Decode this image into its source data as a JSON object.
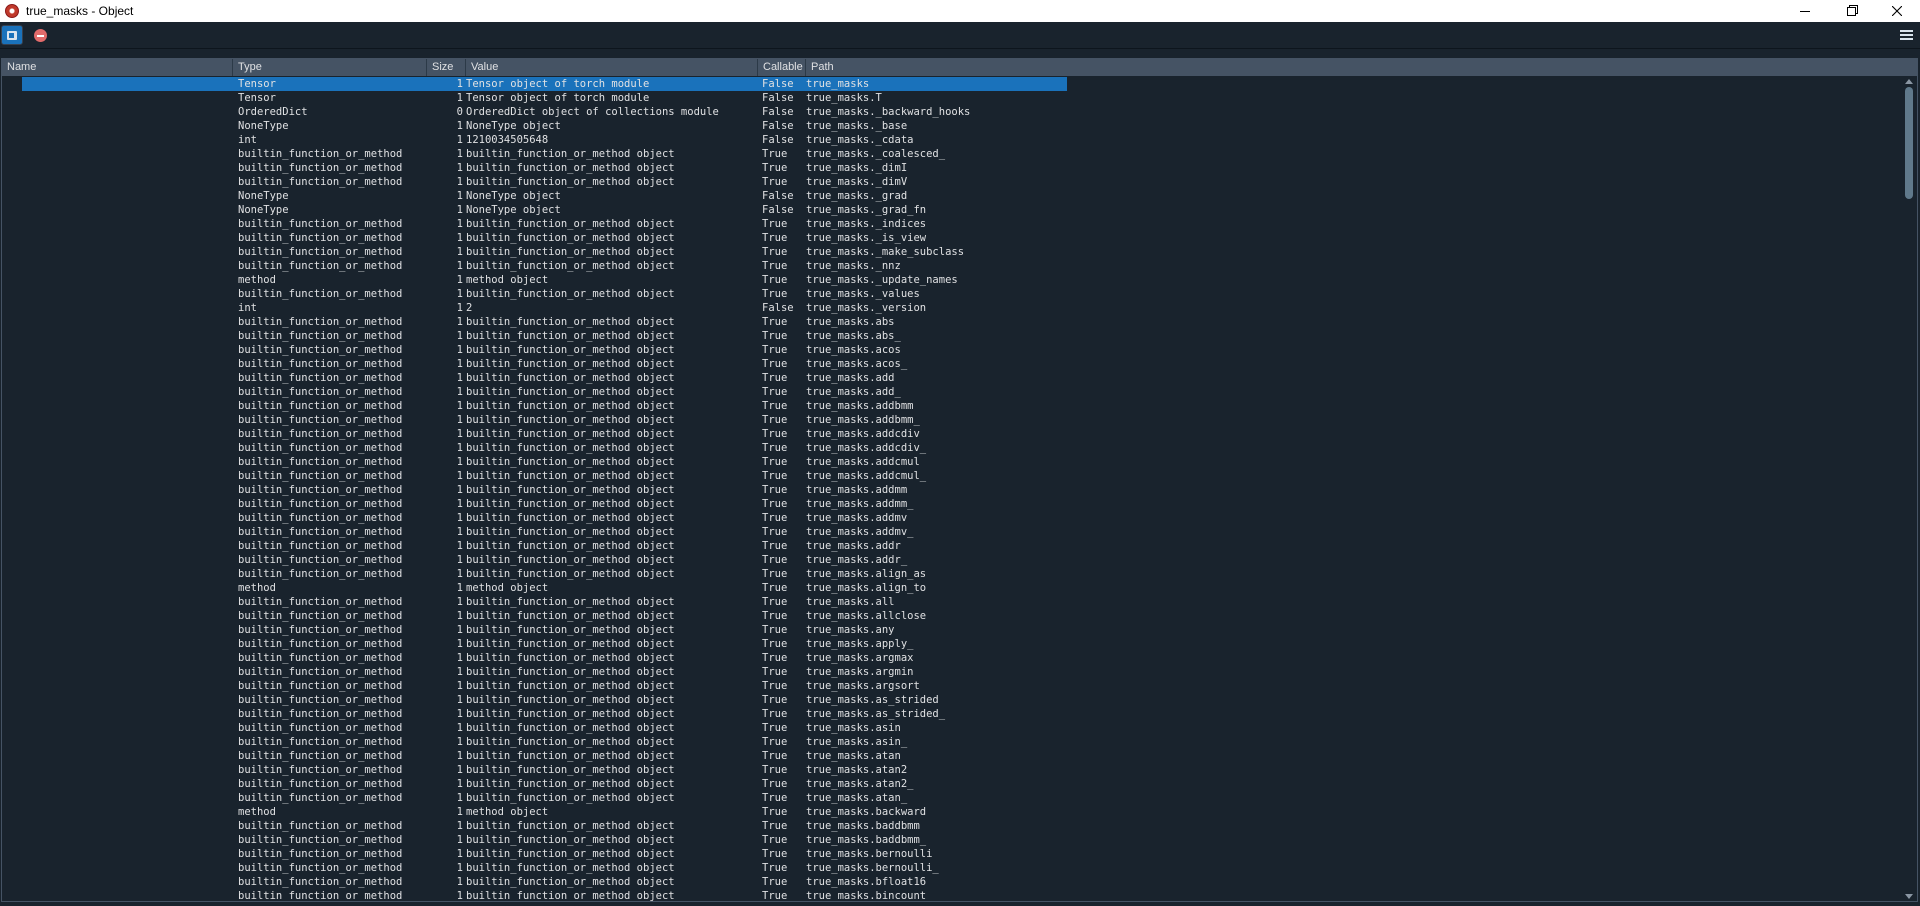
{
  "window": {
    "title": "true_masks - Object",
    "minimize_glyph": "",
    "maximize_glyph": "",
    "close_glyph": ""
  },
  "toolbar": {
    "buttons": [
      "object-view-icon",
      "stop-icon",
      "menu-icon"
    ]
  },
  "columns": [
    "Name",
    "Type",
    "Size",
    "Value",
    "Callable",
    "Path"
  ],
  "root": {
    "name": "true_masks",
    "type": "Tensor",
    "size": "1",
    "value": "Tensor object of torch module",
    "callable": "False",
    "path": "true_masks"
  },
  "rows": [
    [
      "T",
      "Tensor",
      "1",
      "Tensor object of torch module",
      "False",
      "true_masks.T"
    ],
    [
      "_backward_hooks",
      "OrderedDict",
      "0",
      "OrderedDict object of collections module",
      "False",
      "true_masks._backward_hooks"
    ],
    [
      "_base",
      "NoneType",
      "1",
      "NoneType object",
      "False",
      "true_masks._base"
    ],
    [
      "_cdata",
      "int",
      "1",
      "1210034505648",
      "False",
      "true_masks._cdata"
    ],
    [
      "_coalesced_",
      "builtin_function_or_method",
      "1",
      "builtin_function_or_method object",
      "True",
      "true_masks._coalesced_"
    ],
    [
      "_dimI",
      "builtin_function_or_method",
      "1",
      "builtin_function_or_method object",
      "True",
      "true_masks._dimI"
    ],
    [
      "_dimV",
      "builtin_function_or_method",
      "1",
      "builtin_function_or_method object",
      "True",
      "true_masks._dimV"
    ],
    [
      "_grad",
      "NoneType",
      "1",
      "NoneType object",
      "False",
      "true_masks._grad"
    ],
    [
      "_grad_fn",
      "NoneType",
      "1",
      "NoneType object",
      "False",
      "true_masks._grad_fn"
    ],
    [
      "_indices",
      "builtin_function_or_method",
      "1",
      "builtin_function_or_method object",
      "True",
      "true_masks._indices"
    ],
    [
      "_is_view",
      "builtin_function_or_method",
      "1",
      "builtin_function_or_method object",
      "True",
      "true_masks._is_view"
    ],
    [
      "_make_subclass",
      "builtin_function_or_method",
      "1",
      "builtin_function_or_method object",
      "True",
      "true_masks._make_subclass"
    ],
    [
      "_nnz",
      "builtin_function_or_method",
      "1",
      "builtin_function_or_method object",
      "True",
      "true_masks._nnz"
    ],
    [
      "_update_names",
      "method",
      "1",
      "method object",
      "True",
      "true_masks._update_names"
    ],
    [
      "_values",
      "builtin_function_or_method",
      "1",
      "builtin_function_or_method object",
      "True",
      "true_masks._values"
    ],
    [
      "_version",
      "int",
      "1",
      "2",
      "False",
      "true_masks._version"
    ],
    [
      "abs",
      "builtin_function_or_method",
      "1",
      "builtin_function_or_method object",
      "True",
      "true_masks.abs"
    ],
    [
      "abs_",
      "builtin_function_or_method",
      "1",
      "builtin_function_or_method object",
      "True",
      "true_masks.abs_"
    ],
    [
      "acos",
      "builtin_function_or_method",
      "1",
      "builtin_function_or_method object",
      "True",
      "true_masks.acos"
    ],
    [
      "acos_",
      "builtin_function_or_method",
      "1",
      "builtin_function_or_method object",
      "True",
      "true_masks.acos_"
    ],
    [
      "add",
      "builtin_function_or_method",
      "1",
      "builtin_function_or_method object",
      "True",
      "true_masks.add"
    ],
    [
      "add_",
      "builtin_function_or_method",
      "1",
      "builtin_function_or_method object",
      "True",
      "true_masks.add_"
    ],
    [
      "addbmm",
      "builtin_function_or_method",
      "1",
      "builtin_function_or_method object",
      "True",
      "true_masks.addbmm"
    ],
    [
      "addbmm_",
      "builtin_function_or_method",
      "1",
      "builtin_function_or_method object",
      "True",
      "true_masks.addbmm_"
    ],
    [
      "addcdiv",
      "builtin_function_or_method",
      "1",
      "builtin_function_or_method object",
      "True",
      "true_masks.addcdiv"
    ],
    [
      "addcdiv_",
      "builtin_function_or_method",
      "1",
      "builtin_function_or_method object",
      "True",
      "true_masks.addcdiv_"
    ],
    [
      "addcmul",
      "builtin_function_or_method",
      "1",
      "builtin_function_or_method object",
      "True",
      "true_masks.addcmul"
    ],
    [
      "addcmul_",
      "builtin_function_or_method",
      "1",
      "builtin_function_or_method object",
      "True",
      "true_masks.addcmul_"
    ],
    [
      "addmm",
      "builtin_function_or_method",
      "1",
      "builtin_function_or_method object",
      "True",
      "true_masks.addmm"
    ],
    [
      "addmm_",
      "builtin_function_or_method",
      "1",
      "builtin_function_or_method object",
      "True",
      "true_masks.addmm_"
    ],
    [
      "addmv",
      "builtin_function_or_method",
      "1",
      "builtin_function_or_method object",
      "True",
      "true_masks.addmv"
    ],
    [
      "addmv_",
      "builtin_function_or_method",
      "1",
      "builtin_function_or_method object",
      "True",
      "true_masks.addmv_"
    ],
    [
      "addr",
      "builtin_function_or_method",
      "1",
      "builtin_function_or_method object",
      "True",
      "true_masks.addr"
    ],
    [
      "addr_",
      "builtin_function_or_method",
      "1",
      "builtin_function_or_method object",
      "True",
      "true_masks.addr_"
    ],
    [
      "align_as",
      "builtin_function_or_method",
      "1",
      "builtin_function_or_method object",
      "True",
      "true_masks.align_as"
    ],
    [
      "align_to",
      "method",
      "1",
      "method object",
      "True",
      "true_masks.align_to"
    ],
    [
      "all",
      "builtin_function_or_method",
      "1",
      "builtin_function_or_method object",
      "True",
      "true_masks.all"
    ],
    [
      "allclose",
      "builtin_function_or_method",
      "1",
      "builtin_function_or_method object",
      "True",
      "true_masks.allclose"
    ],
    [
      "any",
      "builtin_function_or_method",
      "1",
      "builtin_function_or_method object",
      "True",
      "true_masks.any"
    ],
    [
      "apply_",
      "builtin_function_or_method",
      "1",
      "builtin_function_or_method object",
      "True",
      "true_masks.apply_"
    ],
    [
      "argmax",
      "builtin_function_or_method",
      "1",
      "builtin_function_or_method object",
      "True",
      "true_masks.argmax"
    ],
    [
      "argmin",
      "builtin_function_or_method",
      "1",
      "builtin_function_or_method object",
      "True",
      "true_masks.argmin"
    ],
    [
      "argsort",
      "builtin_function_or_method",
      "1",
      "builtin_function_or_method object",
      "True",
      "true_masks.argsort"
    ],
    [
      "as_strided",
      "builtin_function_or_method",
      "1",
      "builtin_function_or_method object",
      "True",
      "true_masks.as_strided"
    ],
    [
      "as_strided_",
      "builtin_function_or_method",
      "1",
      "builtin_function_or_method object",
      "True",
      "true_masks.as_strided_"
    ],
    [
      "asin",
      "builtin_function_or_method",
      "1",
      "builtin_function_or_method object",
      "True",
      "true_masks.asin"
    ],
    [
      "asin_",
      "builtin_function_or_method",
      "1",
      "builtin_function_or_method object",
      "True",
      "true_masks.asin_"
    ],
    [
      "atan",
      "builtin_function_or_method",
      "1",
      "builtin_function_or_method object",
      "True",
      "true_masks.atan"
    ],
    [
      "atan2",
      "builtin_function_or_method",
      "1",
      "builtin_function_or_method object",
      "True",
      "true_masks.atan2"
    ],
    [
      "atan2_",
      "builtin_function_or_method",
      "1",
      "builtin_function_or_method object",
      "True",
      "true_masks.atan2_"
    ],
    [
      "atan_",
      "builtin_function_or_method",
      "1",
      "builtin_function_or_method object",
      "True",
      "true_masks.atan_"
    ],
    [
      "backward",
      "method",
      "1",
      "method object",
      "True",
      "true_masks.backward"
    ],
    [
      "baddbmm",
      "builtin_function_or_method",
      "1",
      "builtin_function_or_method object",
      "True",
      "true_masks.baddbmm"
    ],
    [
      "baddbmm_",
      "builtin_function_or_method",
      "1",
      "builtin_function_or_method object",
      "True",
      "true_masks.baddbmm_"
    ],
    [
      "bernoulli",
      "builtin_function_or_method",
      "1",
      "builtin_function_or_method object",
      "True",
      "true_masks.bernoulli"
    ],
    [
      "bernoulli_",
      "builtin_function_or_method",
      "1",
      "builtin_function_or_method object",
      "True",
      "true_masks.bernoulli_"
    ],
    [
      "bfloat16",
      "builtin_function_or_method",
      "1",
      "builtin_function_or_method object",
      "True",
      "true_masks.bfloat16"
    ],
    [
      "bincount",
      "builtin_function_or_method",
      "1",
      "builtin_function_or_method object",
      "True",
      "true_masks.bincount"
    ]
  ]
}
